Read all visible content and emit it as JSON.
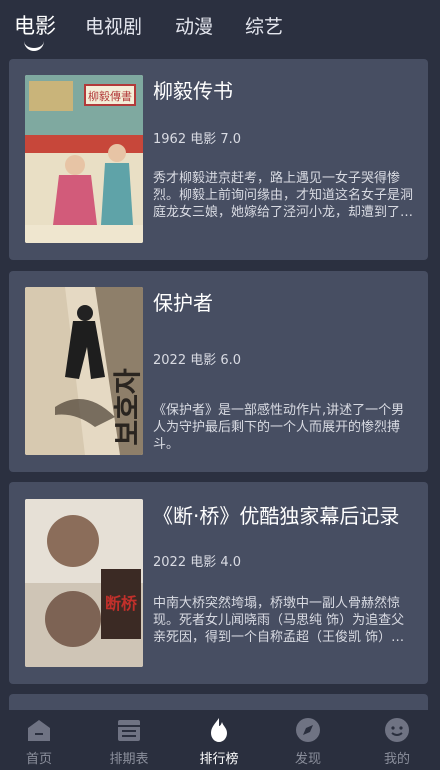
{
  "tabs": [
    {
      "label": "电影",
      "active": true
    },
    {
      "label": "电视剧",
      "active": false
    },
    {
      "label": "动漫",
      "active": false
    },
    {
      "label": "综艺",
      "active": false
    }
  ],
  "cards": [
    {
      "title": "柳毅传书",
      "meta": "1962 电影 7.0",
      "desc": "秀才柳毅进京赶考，路上遇见一女子哭得惨烈。柳毅上前询问缘由，才知道这名女子是洞庭龙女三娘，她嫁给了泾河小龙，却遭到了后者的虐待，冤情无…",
      "poster_text": "柳毅傳書"
    },
    {
      "title": "保护者",
      "meta": "2022 电影 6.0",
      "desc": "《保护者》是一部感性动作片,讲述了一个男人为守护最后剩下的一个人而展开的惨烈搏斗。",
      "poster_text": "보호자"
    },
    {
      "title": "《断·桥》优酷独家幕后记录",
      "meta": "2022 电影 4.0",
      "desc": "中南大桥突然垮塌，桥墩中一副人骨赫然惊现。死者女儿闻晓雨（马思纯 饰）为追查父亲死因，得到一个自称孟超（王俊凯 饰）的男孩协助，并携手走…",
      "poster_text": "断桥"
    }
  ],
  "nav": [
    {
      "label": "首页",
      "icon": "home-icon",
      "active": false
    },
    {
      "label": "排期表",
      "icon": "calendar-icon",
      "active": false
    },
    {
      "label": "排行榜",
      "icon": "flame-icon",
      "active": true
    },
    {
      "label": "发现",
      "icon": "compass-icon",
      "active": false
    },
    {
      "label": "我的",
      "icon": "profile-icon",
      "active": false
    }
  ],
  "colors": {
    "background": "#2b3040",
    "card": "#474e62",
    "nav_inactive": "#8b8f9c",
    "nav_active": "#ffffff"
  }
}
